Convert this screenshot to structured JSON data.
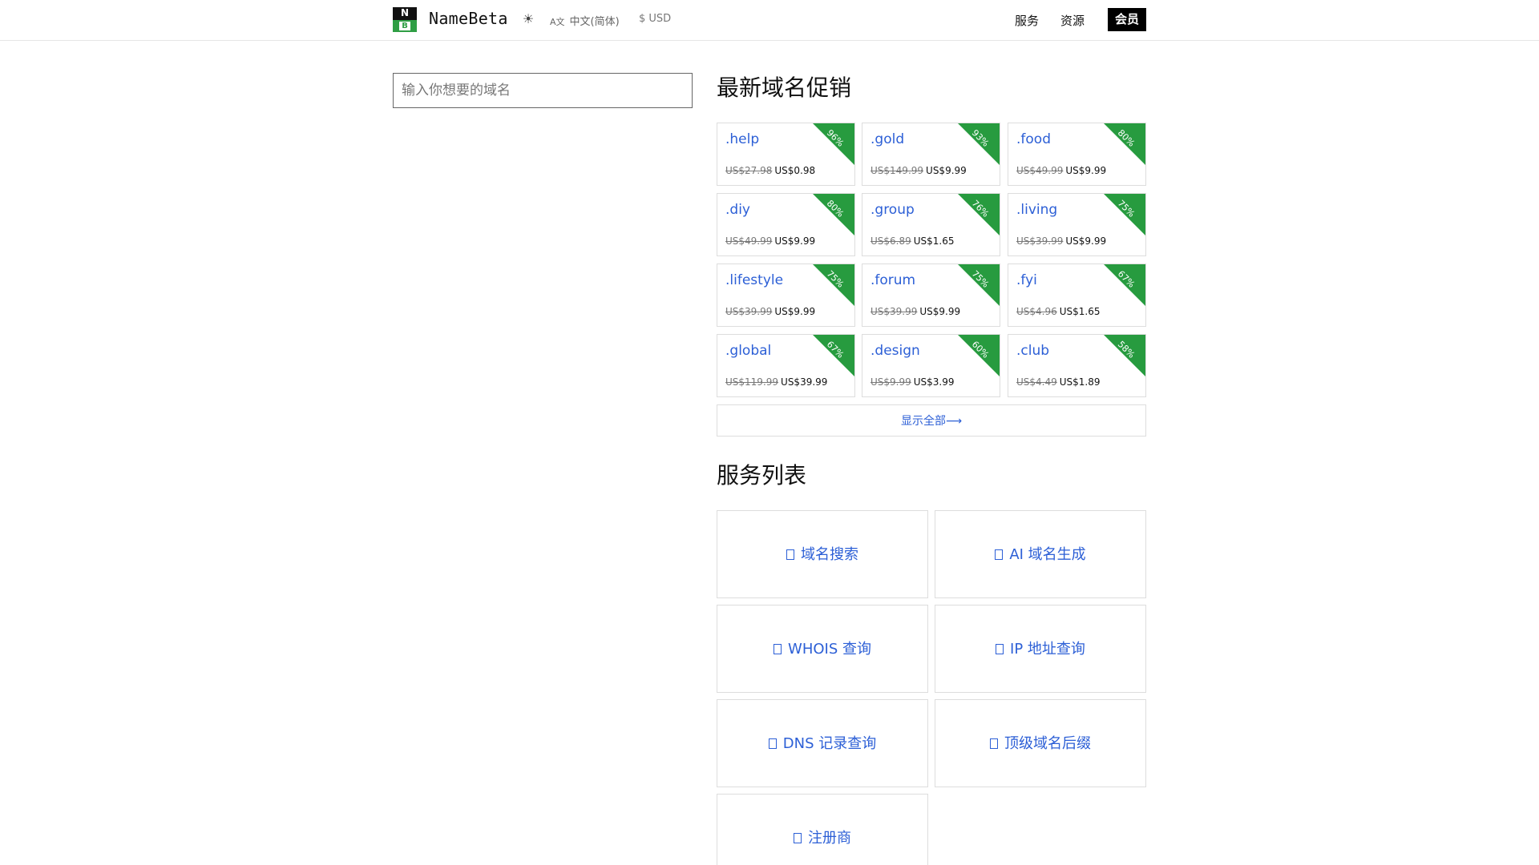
{
  "header": {
    "brand": "NameBeta",
    "logo_letters": {
      "top": "N",
      "bottom": "B"
    },
    "theme_icon": "sun-icon",
    "language_icon": "translate-icon",
    "language": "中文(简体)",
    "currency": "$ USD",
    "nav": {
      "services": "服务",
      "resources": "资源",
      "member": "会员"
    }
  },
  "search": {
    "placeholder": "输入你想要的域名"
  },
  "promo": {
    "title": "最新域名促销",
    "items": [
      {
        "tld": ".help",
        "old_price": "US$27.98",
        "price": "US$0.98",
        "discount": "96%"
      },
      {
        "tld": ".gold",
        "old_price": "US$149.99",
        "price": "US$9.99",
        "discount": "93%"
      },
      {
        "tld": ".food",
        "old_price": "US$49.99",
        "price": "US$9.99",
        "discount": "80%"
      },
      {
        "tld": ".diy",
        "old_price": "US$49.99",
        "price": "US$9.99",
        "discount": "80%"
      },
      {
        "tld": ".group",
        "old_price": "US$6.89",
        "price": "US$1.65",
        "discount": "76%"
      },
      {
        "tld": ".living",
        "old_price": "US$39.99",
        "price": "US$9.99",
        "discount": "75%"
      },
      {
        "tld": ".lifestyle",
        "old_price": "US$39.99",
        "price": "US$9.99",
        "discount": "75%"
      },
      {
        "tld": ".forum",
        "old_price": "US$39.99",
        "price": "US$9.99",
        "discount": "75%"
      },
      {
        "tld": ".fyi",
        "old_price": "US$4.96",
        "price": "US$1.65",
        "discount": "67%"
      },
      {
        "tld": ".global",
        "old_price": "US$119.99",
        "price": "US$39.99",
        "discount": "67%"
      },
      {
        "tld": ".design",
        "old_price": "US$9.99",
        "price": "US$3.99",
        "discount": "60%"
      },
      {
        "tld": ".club",
        "old_price": "US$4.49",
        "price": "US$1.89",
        "discount": "58%"
      }
    ],
    "show_all": "显示全部⟶"
  },
  "services": {
    "title": "服务列表",
    "items": [
      {
        "label": "域名搜索",
        "icon": "search-icon"
      },
      {
        "label": "AI 域名生成",
        "icon": "ai-icon"
      },
      {
        "label": "WHOIS 查询",
        "icon": "whois-icon"
      },
      {
        "label": "IP 地址查询",
        "icon": "ip-icon"
      },
      {
        "label": "DNS 记录查询",
        "icon": "dns-icon"
      },
      {
        "label": "顶级域名后缀",
        "icon": "tld-icon"
      },
      {
        "label": "注册商",
        "icon": "registrar-icon"
      }
    ]
  }
}
